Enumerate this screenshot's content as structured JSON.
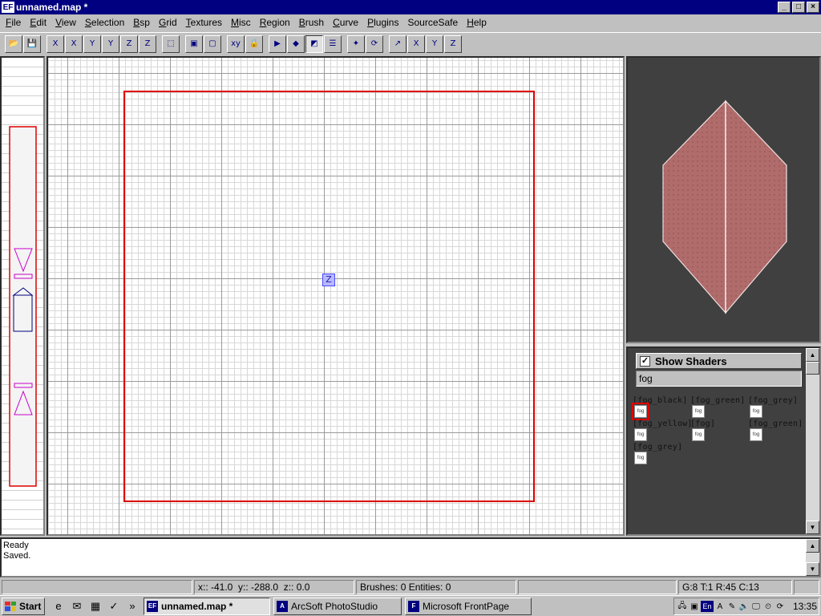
{
  "window": {
    "app_icon": "EF",
    "title": "unnamed.map *",
    "controls": [
      "_",
      "□",
      "×"
    ]
  },
  "menu": [
    {
      "label": "File",
      "u": "F",
      "rest": "ile"
    },
    {
      "label": "Edit",
      "u": "E",
      "rest": "dit"
    },
    {
      "label": "View",
      "u": "V",
      "rest": "iew"
    },
    {
      "label": "Selection",
      "u": "S",
      "rest": "election"
    },
    {
      "label": "Bsp",
      "u": "B",
      "rest": "sp"
    },
    {
      "label": "Grid",
      "u": "G",
      "rest": "rid"
    },
    {
      "label": "Textures",
      "u": "T",
      "rest": "extures"
    },
    {
      "label": "Misc",
      "u": "M",
      "rest": "isc"
    },
    {
      "label": "Region",
      "u": "R",
      "rest": "egion"
    },
    {
      "label": "Brush",
      "u": "B",
      "rest": "rush"
    },
    {
      "label": "Curve",
      "u": "C",
      "rest": "urve"
    },
    {
      "label": "Plugins",
      "u": "P",
      "rest": "lugins"
    },
    {
      "label": "SourceSafe",
      "u": "",
      "rest": "SourceSafe"
    },
    {
      "label": "Help",
      "u": "H",
      "rest": "elp"
    }
  ],
  "toolbar": [
    {
      "name": "open-icon",
      "glyph": "📂"
    },
    {
      "name": "save-icon",
      "glyph": "💾"
    },
    {
      "sep": true
    },
    {
      "name": "flip-x-icon",
      "glyph": "X"
    },
    {
      "name": "rotate-x-icon",
      "glyph": "X"
    },
    {
      "name": "flip-y-icon",
      "glyph": "Y"
    },
    {
      "name": "rotate-y-icon",
      "glyph": "Y"
    },
    {
      "name": "flip-z-icon",
      "glyph": "Z"
    },
    {
      "name": "rotate-z-icon",
      "glyph": "Z"
    },
    {
      "sep": true
    },
    {
      "name": "selection-icon",
      "glyph": "⬚"
    },
    {
      "sep": true
    },
    {
      "name": "csg-subtract-icon",
      "glyph": "▣"
    },
    {
      "name": "csg-merge-icon",
      "glyph": "▢"
    },
    {
      "sep": true
    },
    {
      "name": "change-view-icon",
      "glyph": "xy"
    },
    {
      "name": "texture-lock-icon",
      "glyph": "🔒"
    },
    {
      "sep": true
    },
    {
      "name": "clipper-icon",
      "glyph": "▶"
    },
    {
      "name": "drag-edges-icon",
      "glyph": "◆"
    },
    {
      "name": "drag-faces-icon",
      "glyph": "◩",
      "pressed": true
    },
    {
      "name": "entity-list-icon",
      "glyph": "☰"
    },
    {
      "sep": true
    },
    {
      "name": "vertex-edit-icon",
      "glyph": "✦"
    },
    {
      "name": "rotate-view-icon",
      "glyph": "⟳"
    },
    {
      "sep": true
    },
    {
      "name": "scale-icon",
      "glyph": "↗"
    },
    {
      "name": "axis-x-icon",
      "glyph": "X"
    },
    {
      "name": "axis-y-icon",
      "glyph": "Y"
    },
    {
      "name": "axis-z-icon",
      "glyph": "Z"
    }
  ],
  "xy_view": {
    "z_marker": "Z"
  },
  "texture_panel": {
    "show_shaders_label": "Show Shaders",
    "filter_value": "fog",
    "thumb_label": "fog",
    "textures": [
      {
        "name": "fog_black",
        "label": "[fog_black]",
        "selected": true
      },
      {
        "name": "fog_green",
        "label": "[fog_green]",
        "selected": false
      },
      {
        "name": "fog_grey",
        "label": "[fog_grey]",
        "selected": false
      },
      {
        "name": "fog_yellow",
        "label": "[fog_yellow]",
        "selected": false
      },
      {
        "name": "fog_2",
        "label": "[fog]",
        "selected": false
      },
      {
        "name": "fog_green_2",
        "label": "[fog_green]",
        "selected": false
      },
      {
        "name": "fog_grey_2",
        "label": "[fog_grey]",
        "selected": false
      }
    ]
  },
  "console": {
    "lines": [
      "Ready",
      "Saved."
    ]
  },
  "status": {
    "coords": "x:: -41.0  y:: -288.0  z:: 0.0",
    "counts": "Brushes: 0 Entities: 0",
    "grid": "G:8 T:1 R:45 C:13"
  },
  "taskbar": {
    "start_label": "Start",
    "quick_launch": [
      {
        "name": "ie-icon",
        "glyph": "e"
      },
      {
        "name": "outlook-icon",
        "glyph": "✉"
      },
      {
        "name": "desktop-icon",
        "glyph": "▦"
      },
      {
        "name": "channels-icon",
        "glyph": "✓"
      }
    ],
    "more_glyph": "»",
    "tasks": [
      {
        "label": "unnamed.map *",
        "icon": "EF",
        "active": true
      },
      {
        "label": "ArcSoft PhotoStudio",
        "icon": "A",
        "active": false
      },
      {
        "label": "Microsoft FrontPage",
        "icon": "F",
        "active": false
      }
    ],
    "tray_lang": "En",
    "clock": "13:35"
  },
  "colors": {
    "brush_outline": "#dd0000",
    "brush_face": "#b06b6b",
    "z_marker": "#4a4aff",
    "title_bar": "#000080"
  }
}
